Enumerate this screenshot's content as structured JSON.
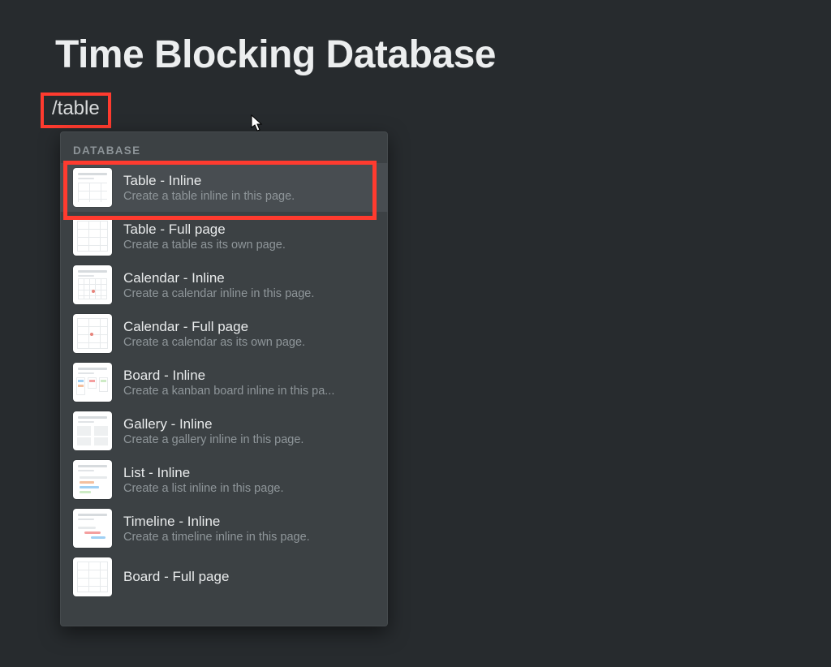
{
  "page": {
    "title": "Time Blocking Database"
  },
  "input": {
    "command": "/table"
  },
  "menu": {
    "section": "DATABASE",
    "items": [
      {
        "title": "Table - Inline",
        "desc": "Create a table inline in this page.",
        "icon": "table-inline-icon"
      },
      {
        "title": "Table - Full page",
        "desc": "Create a table as its own page.",
        "icon": "table-full-icon"
      },
      {
        "title": "Calendar - Inline",
        "desc": "Create a calendar inline in this page.",
        "icon": "calendar-inline-icon"
      },
      {
        "title": "Calendar - Full page",
        "desc": "Create a calendar as its own page.",
        "icon": "calendar-full-icon"
      },
      {
        "title": "Board - Inline",
        "desc": "Create a kanban board inline in this pa...",
        "icon": "board-inline-icon"
      },
      {
        "title": "Gallery - Inline",
        "desc": "Create a gallery inline in this page.",
        "icon": "gallery-inline-icon"
      },
      {
        "title": "List - Inline",
        "desc": "Create a list inline in this page.",
        "icon": "list-inline-icon"
      },
      {
        "title": "Timeline - Inline",
        "desc": "Create a timeline inline in this page.",
        "icon": "timeline-inline-icon"
      },
      {
        "title": "Board - Full page",
        "desc": "",
        "icon": "board-full-icon"
      }
    ]
  }
}
